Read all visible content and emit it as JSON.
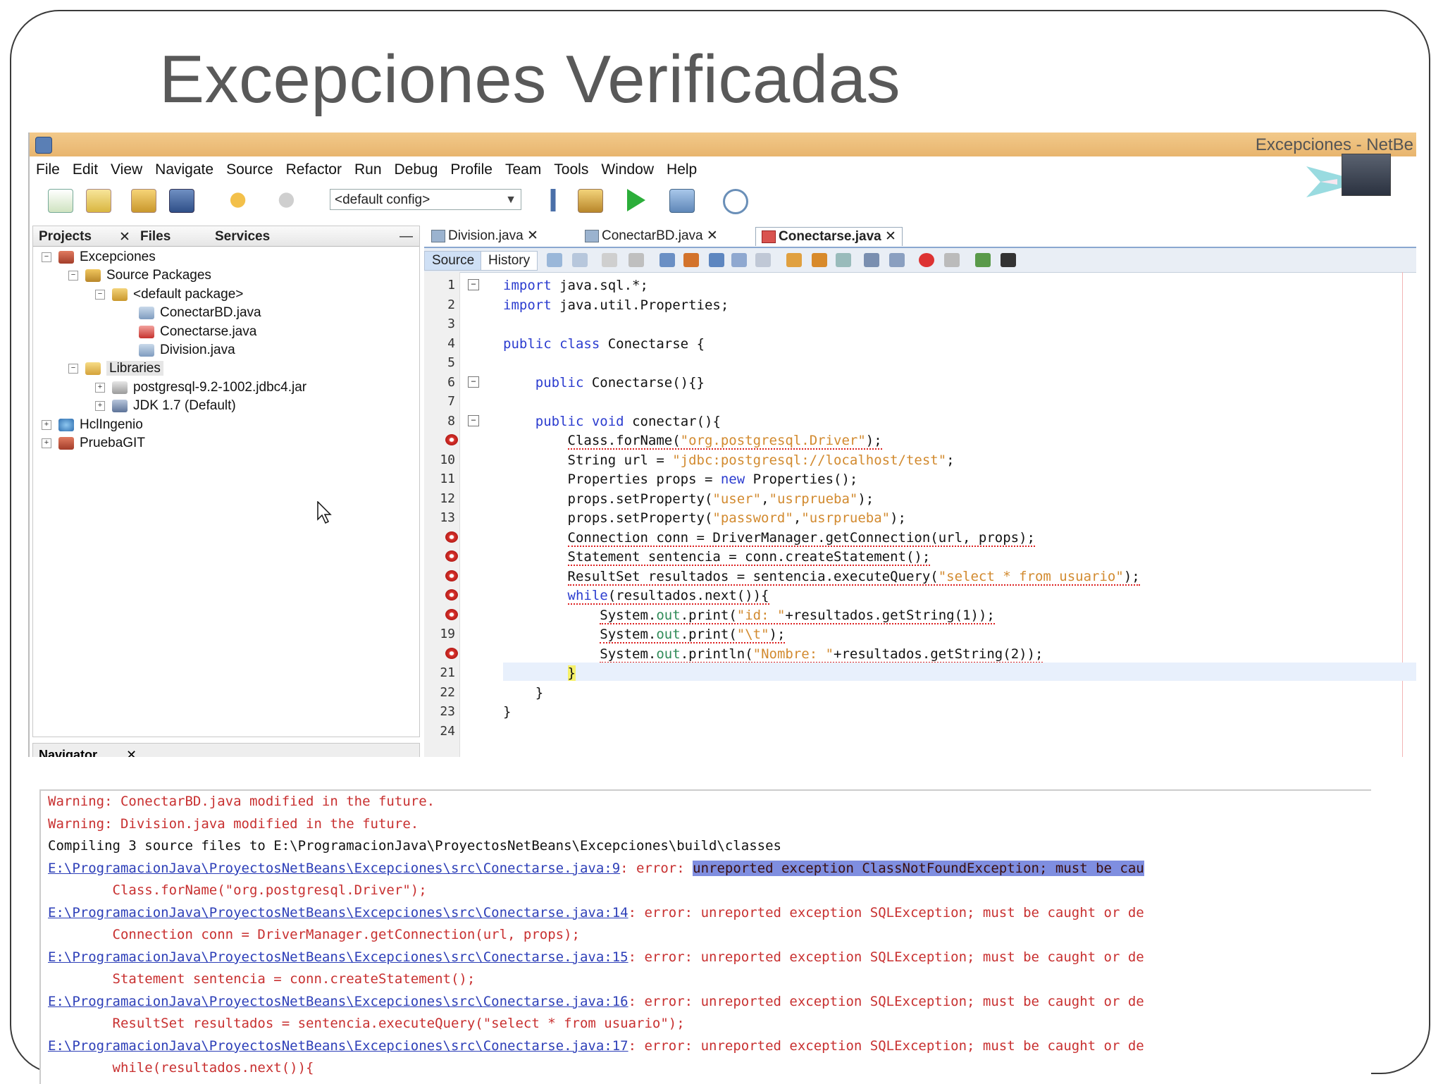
{
  "slide": {
    "title": "Excepciones Verificadas"
  },
  "window": {
    "title": "Excepciones - NetBe"
  },
  "menu": [
    "File",
    "Edit",
    "View",
    "Navigate",
    "Source",
    "Refactor",
    "Run",
    "Debug",
    "Profile",
    "Team",
    "Tools",
    "Window",
    "Help"
  ],
  "toolbar": {
    "config_value": "<default config>"
  },
  "projects_panel": {
    "tabs": [
      "Projects",
      "Files",
      "Services"
    ],
    "tree": [
      {
        "label": "Excepciones",
        "depth": 0,
        "icon": "coffee-project-icon"
      },
      {
        "label": "Source Packages",
        "depth": 1,
        "icon": "source-packages-icon"
      },
      {
        "label": "<default package>",
        "depth": 2,
        "icon": "package-icon"
      },
      {
        "label": "ConectarBD.java",
        "depth": 3,
        "icon": "java-file-icon"
      },
      {
        "label": "Conectarse.java",
        "depth": 3,
        "icon": "java-file-error-icon"
      },
      {
        "label": "Division.java",
        "depth": 3,
        "icon": "java-file-icon"
      },
      {
        "label": "Libraries",
        "depth": 1,
        "icon": "libraries-folder-icon"
      },
      {
        "label": "postgresql-9.2-1002.jdbc4.jar",
        "depth": 2,
        "icon": "jar-icon"
      },
      {
        "label": "JDK 1.7 (Default)",
        "depth": 2,
        "icon": "jdk-icon"
      },
      {
        "label": "HclIngenio",
        "depth": 0,
        "icon": "globe-project-icon"
      },
      {
        "label": "PruebaGIT",
        "depth": 0,
        "icon": "coffee-project-icon"
      }
    ],
    "navigator_label": "Navigator"
  },
  "editor": {
    "tabs": [
      {
        "label": "Division.java",
        "active": false
      },
      {
        "label": "ConectarBD.java",
        "active": false
      },
      {
        "label": "Conectarse.java",
        "active": true
      }
    ],
    "source_tab": "Source",
    "history_tab": "History",
    "line_numbers": [
      "1",
      "2",
      "3",
      "4",
      "5",
      "6",
      "7",
      "8",
      "",
      "10",
      "11",
      "12",
      "13",
      "",
      "",
      "",
      "",
      "",
      "19",
      "",
      "21",
      "22",
      "23",
      "24"
    ],
    "code_lines": [
      "import java.sql.*;",
      "import java.util.Properties;",
      "",
      "public class Conectarse {",
      "",
      "    public Conectarse(){}",
      "",
      "    public void conectar(){",
      "        Class.forName(\"org.postgresql.Driver\");",
      "        String url = \"jdbc:postgresql://localhost/test\";",
      "        Properties props = new Properties();",
      "        props.setProperty(\"user\",\"usrprueba\");",
      "        props.setProperty(\"password\",\"usrprueba\");",
      "        Connection conn = DriverManager.getConnection(url, props);",
      "        Statement sentencia = conn.createStatement();",
      "        ResultSet resultados = sentencia.executeQuery(\"select * from usuario\");",
      "        while(resultados.next()){",
      "            System.out.print(\"id: \"+resultados.getString(1));",
      "            System.out.print(\"\\t\");",
      "            System.out.println(\"Nombre: \"+resultados.getString(2));",
      "        }",
      "    }",
      "}",
      ""
    ]
  },
  "output": {
    "lines": [
      {
        "text": "Warning: ConectarBD.java modified in the future.",
        "kind": "warn"
      },
      {
        "text": "Warning: Division.java modified in the future.",
        "kind": "warn"
      },
      {
        "text": "Compiling 3 source files to E:\\ProgramacionJava\\ProyectosNetBeans\\Excepciones\\build\\classes",
        "kind": "info"
      },
      {
        "link": "E:\\ProgramacionJava\\ProyectosNetBeans\\Excepciones\\src\\Conectarse.java:9",
        "err": ": error: ",
        "msg": "unreported exception ClassNotFoundException; must be cau",
        "kind": "error",
        "highlight": true
      },
      {
        "text": "        Class.forName(\"org.postgresql.Driver\");",
        "kind": "code"
      },
      {
        "link": "E:\\ProgramacionJava\\ProyectosNetBeans\\Excepciones\\src\\Conectarse.java:14",
        "err": ": error: ",
        "msg": "unreported exception SQLException; must be caught or de",
        "kind": "error"
      },
      {
        "text": "        Connection conn = DriverManager.getConnection(url, props);",
        "kind": "code"
      },
      {
        "link": "E:\\ProgramacionJava\\ProyectosNetBeans\\Excepciones\\src\\Conectarse.java:15",
        "err": ": error: ",
        "msg": "unreported exception SQLException; must be caught or de",
        "kind": "error"
      },
      {
        "text": "        Statement sentencia = conn.createStatement();",
        "kind": "code"
      },
      {
        "link": "E:\\ProgramacionJava\\ProyectosNetBeans\\Excepciones\\src\\Conectarse.java:16",
        "err": ": error: ",
        "msg": "unreported exception SQLException; must be caught or de",
        "kind": "error"
      },
      {
        "text": "        ResultSet resultados = sentencia.executeQuery(\"select * from usuario\");",
        "kind": "code"
      },
      {
        "link": "E:\\ProgramacionJava\\ProyectosNetBeans\\Excepciones\\src\\Conectarse.java:17",
        "err": ": error: ",
        "msg": "unreported exception SQLException; must be caught or de",
        "kind": "error"
      },
      {
        "text": "        while(resultados.next()){",
        "kind": "code"
      }
    ]
  },
  "colors": {
    "titlebar": "#e8b56e",
    "keyword": "#2b3ccf",
    "string": "#d28a2f",
    "field": "#2e8b57",
    "error": "#c83030",
    "link": "#2d3fb8"
  }
}
